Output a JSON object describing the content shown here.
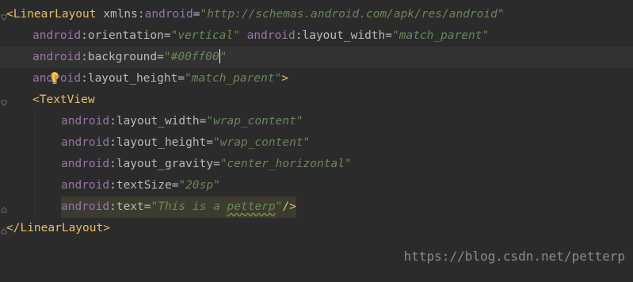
{
  "editor": {
    "lines": [
      {
        "tokens": [
          {
            "t": "<",
            "c": "bracket"
          },
          {
            "t": "LinearLayout",
            "c": "tag"
          },
          {
            "t": " xmlns",
            "c": "attr"
          },
          {
            "t": ":",
            "c": "punct"
          },
          {
            "t": "android",
            "c": "ns"
          },
          {
            "t": "=",
            "c": "punct"
          },
          {
            "t": "\"http://schemas.android.com/apk/res/android\"",
            "c": "str"
          }
        ]
      },
      {
        "tokens": [
          {
            "t": "android",
            "c": "ns"
          },
          {
            "t": ":orientation",
            "c": "attr"
          },
          {
            "t": "=",
            "c": "punct"
          },
          {
            "t": "\"vertical\"",
            "c": "str"
          },
          {
            "t": " android",
            "c": "ns"
          },
          {
            "t": ":layout_width",
            "c": "attr"
          },
          {
            "t": "=",
            "c": "punct"
          },
          {
            "t": "\"match_parent\"",
            "c": "str"
          }
        ]
      },
      {
        "tokens": [
          {
            "t": "android",
            "c": "ns"
          },
          {
            "t": ":background",
            "c": "attr"
          },
          {
            "t": "=",
            "c": "punct"
          },
          {
            "t": "\"#00ff00",
            "c": "str"
          },
          {
            "t": "|",
            "c": "caret"
          },
          {
            "t": "\"",
            "c": "str"
          }
        ]
      },
      {
        "tokens": [
          {
            "t": "android",
            "c": "ns"
          },
          {
            "t": ":layout_height",
            "c": "attr"
          },
          {
            "t": "=",
            "c": "punct"
          },
          {
            "t": "\"match_parent\"",
            "c": "str"
          },
          {
            "t": ">",
            "c": "bracket"
          }
        ]
      },
      {
        "tokens": [
          {
            "t": "<",
            "c": "bracket"
          },
          {
            "t": "TextView",
            "c": "tag"
          }
        ]
      },
      {
        "tokens": [
          {
            "t": "android",
            "c": "ns"
          },
          {
            "t": ":layout_width",
            "c": "attr"
          },
          {
            "t": "=",
            "c": "punct"
          },
          {
            "t": "\"wrap_content\"",
            "c": "str"
          }
        ]
      },
      {
        "tokens": [
          {
            "t": "android",
            "c": "ns"
          },
          {
            "t": ":layout_height",
            "c": "attr"
          },
          {
            "t": "=",
            "c": "punct"
          },
          {
            "t": "\"wrap_content\"",
            "c": "str"
          }
        ]
      },
      {
        "tokens": [
          {
            "t": "android",
            "c": "ns"
          },
          {
            "t": ":layout_gravity",
            "c": "attr"
          },
          {
            "t": "=",
            "c": "punct"
          },
          {
            "t": "\"center_horizontal\"",
            "c": "str"
          }
        ]
      },
      {
        "tokens": [
          {
            "t": "android",
            "c": "ns"
          },
          {
            "t": ":textSize",
            "c": "attr"
          },
          {
            "t": "=",
            "c": "punct"
          },
          {
            "t": "\"20sp\"",
            "c": "str"
          }
        ]
      },
      {
        "tokens": [
          {
            "t": "android",
            "c": "ns"
          },
          {
            "t": ":text",
            "c": "attr"
          },
          {
            "t": "=",
            "c": "punct"
          },
          {
            "t": "\"This is a ",
            "c": "str"
          },
          {
            "t": "petterp",
            "c": "str-squiggle"
          },
          {
            "t": "\"",
            "c": "str"
          },
          {
            "t": "/>",
            "c": "bracket"
          }
        ]
      },
      {
        "tokens": [
          {
            "t": "</",
            "c": "bracket"
          },
          {
            "t": "LinearLayout",
            "c": "tag"
          },
          {
            "t": ">",
            "c": "bracket"
          }
        ]
      }
    ]
  },
  "watermark": "https://blog.csdn.net/petterp",
  "colors": {
    "background": "#2b2b2b",
    "tag": "#e8bf6a",
    "namespace": "#9876aa",
    "attribute": "#bababa",
    "string": "#6a8759",
    "current_line": "#323232"
  },
  "icons": {
    "intention_bulb": "lightbulb-icon"
  }
}
